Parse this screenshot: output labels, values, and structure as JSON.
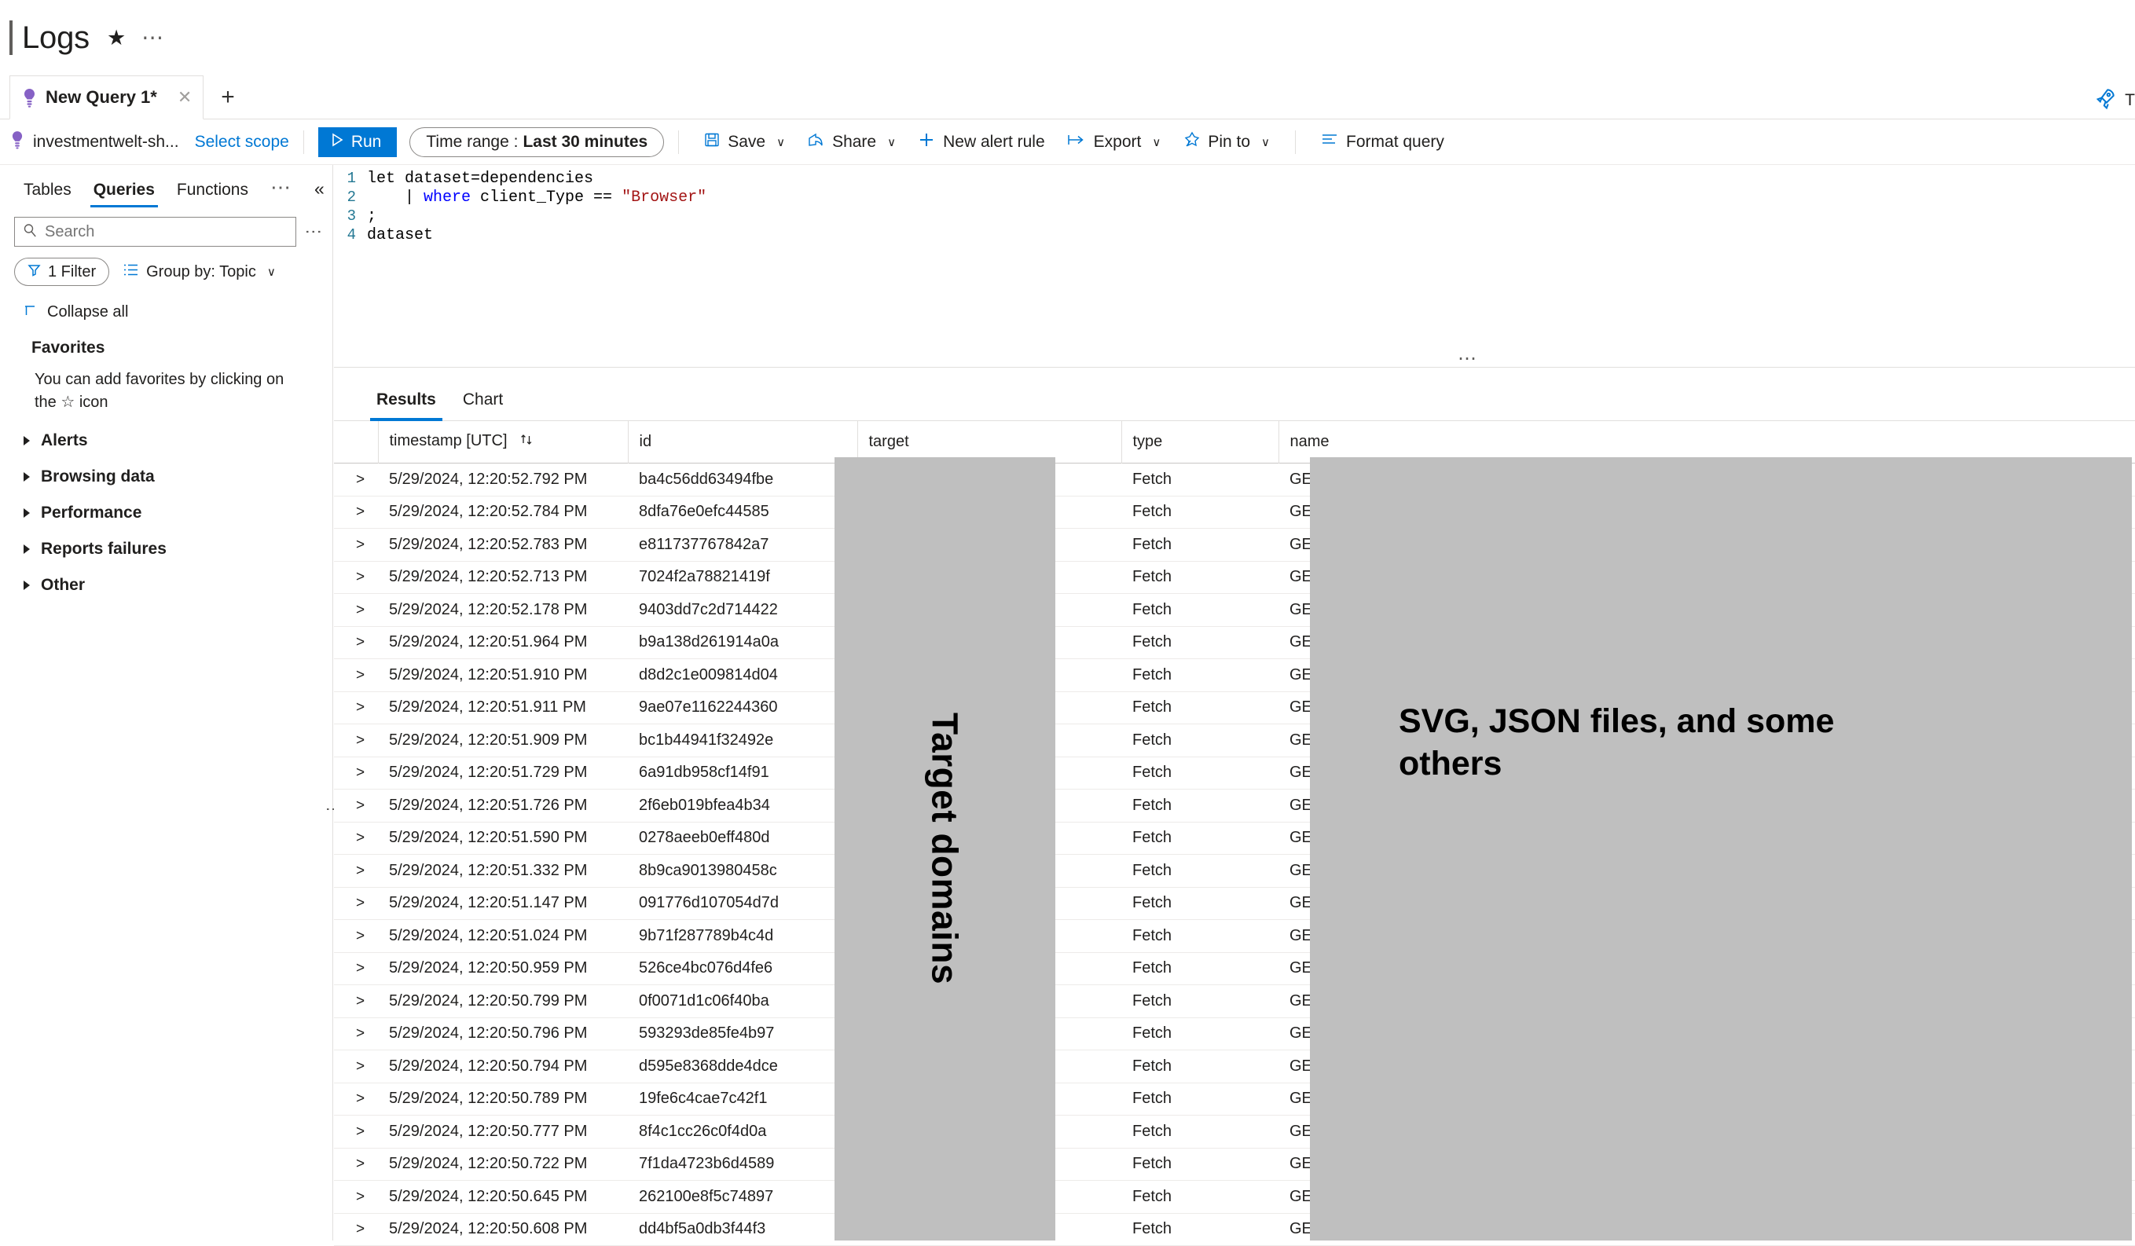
{
  "header": {
    "title": "Logs",
    "favorite_icon": "star-icon",
    "more_icon": "ellipsis-icon"
  },
  "query_tabs": {
    "tabs": [
      {
        "label": "New Query 1*",
        "icon": "lightbulb-icon",
        "close_icon": "close-icon",
        "active": true
      }
    ],
    "add_label": "+",
    "rocket_label": "T",
    "rocket_icon": "rocket-icon"
  },
  "command_bar": {
    "scope_icon": "lightbulb-icon",
    "scope_name": "investmentwelt-sh...",
    "select_scope": "Select scope",
    "run": {
      "label": "Run",
      "icon": "play-icon"
    },
    "time_range": {
      "label": "Time range :",
      "value": "Last 30 minutes"
    },
    "buttons": [
      {
        "label": "Save",
        "icon": "save-icon",
        "chevron": "∨"
      },
      {
        "label": "Share",
        "icon": "share-icon",
        "chevron": "∨"
      },
      {
        "label": "New alert rule",
        "icon": "plus-icon",
        "chevron": ""
      },
      {
        "label": "Export",
        "icon": "export-icon",
        "chevron": "∨"
      },
      {
        "label": "Pin to",
        "icon": "pin-icon",
        "chevron": "∨"
      },
      {
        "label": "Format query",
        "icon": "format-icon",
        "chevron": ""
      }
    ]
  },
  "sidebar": {
    "tabs": [
      {
        "label": "Tables",
        "active": false
      },
      {
        "label": "Queries",
        "active": true
      },
      {
        "label": "Functions",
        "active": false
      }
    ],
    "more_icon": "ellipsis-icon",
    "collapse_icon": "chevron-double-left-icon",
    "search": {
      "placeholder": "Search",
      "value": "",
      "icon": "search-icon"
    },
    "kebab_icon": "kebab-menu-icon",
    "filter_pill": {
      "label": "1 Filter",
      "icon": "filter-icon"
    },
    "group_by": {
      "label": "Group by: Topic",
      "icon": "list-icon",
      "chevron": "∨"
    },
    "collapse_all": {
      "label": "Collapse all",
      "icon": "collapse-all-icon"
    },
    "favorites_title": "Favorites",
    "favorites_hint": "You can add favorites by clicking on the ☆ icon",
    "tree": [
      {
        "label": "Alerts"
      },
      {
        "label": "Browsing data"
      },
      {
        "label": "Performance"
      },
      {
        "label": "Reports failures"
      },
      {
        "label": "Other"
      }
    ]
  },
  "editor": {
    "lines": [
      {
        "num": "1",
        "segments": [
          {
            "text": "let dataset=dependencies",
            "style": "plain"
          }
        ]
      },
      {
        "num": "2",
        "segments": [
          {
            "text": "    | ",
            "style": "plain"
          },
          {
            "text": "where",
            "style": "kw"
          },
          {
            "text": " client_Type == ",
            "style": "plain"
          },
          {
            "text": "\"Browser\"",
            "style": "str"
          }
        ]
      },
      {
        "num": "3",
        "segments": [
          {
            "text": ";",
            "style": "plain"
          }
        ]
      },
      {
        "num": "4",
        "segments": [
          {
            "text": "dataset",
            "style": "plain"
          }
        ]
      }
    ],
    "drag_handle_icon": "drag-dots-icon"
  },
  "results": {
    "tabs": [
      {
        "label": "Results",
        "active": true
      },
      {
        "label": "Chart",
        "active": false
      }
    ],
    "columns": [
      {
        "key": "expand",
        "label": ""
      },
      {
        "key": "timestamp",
        "label": "timestamp [UTC]",
        "sort_icon": "sort-asc-desc-icon"
      },
      {
        "key": "id",
        "label": "id"
      },
      {
        "key": "target",
        "label": "target"
      },
      {
        "key": "type",
        "label": "type"
      },
      {
        "key": "name",
        "label": "name"
      }
    ],
    "rows": [
      {
        "expand": ">",
        "timestamp": "5/29/2024, 12:20:52.792 PM",
        "id": "ba4c56dd63494fbe",
        "target": "",
        "type": "Fetch",
        "name": "GET http"
      },
      {
        "expand": ">",
        "timestamp": "5/29/2024, 12:20:52.784 PM",
        "id": "8dfa76e0efc44585",
        "target": "",
        "type": "Fetch",
        "name": "GET http"
      },
      {
        "expand": ">",
        "timestamp": "5/29/2024, 12:20:52.783 PM",
        "id": "e811737767842a7",
        "target": "",
        "type": "Fetch",
        "name": "GET http"
      },
      {
        "expand": ">",
        "timestamp": "5/29/2024, 12:20:52.713 PM",
        "id": "7024f2a78821419f",
        "target": "",
        "type": "Fetch",
        "name": "GET http"
      },
      {
        "expand": ">",
        "timestamp": "5/29/2024, 12:20:52.178 PM",
        "id": "9403dd7c2d714422",
        "target": "",
        "type": "Fetch",
        "name": "GET http"
      },
      {
        "expand": ">",
        "timestamp": "5/29/2024, 12:20:51.964 PM",
        "id": "b9a138d261914a0a",
        "target": "",
        "type": "Fetch",
        "name": "GET http"
      },
      {
        "expand": ">",
        "timestamp": "5/29/2024, 12:20:51.910 PM",
        "id": "d8d2c1e009814d04",
        "target": "",
        "type": "Fetch",
        "name": "GET http"
      },
      {
        "expand": ">",
        "timestamp": "5/29/2024, 12:20:51.911 PM",
        "id": "9ae07e1162244360",
        "target": "",
        "type": "Fetch",
        "name": "GET http"
      },
      {
        "expand": ">",
        "timestamp": "5/29/2024, 12:20:51.909 PM",
        "id": "bc1b44941f32492e",
        "target": "",
        "type": "Fetch",
        "name": "GET http"
      },
      {
        "expand": ">",
        "timestamp": "5/29/2024, 12:20:51.729 PM",
        "id": "6a91db958cf14f91",
        "target": "",
        "type": "Fetch",
        "name": "GET http"
      },
      {
        "expand": ">",
        "timestamp": "5/29/2024, 12:20:51.726 PM",
        "id": "2f6eb019bfea4b34",
        "target": "",
        "type": "Fetch",
        "name": "GET http"
      },
      {
        "expand": ">",
        "timestamp": "5/29/2024, 12:20:51.590 PM",
        "id": "0278aeeb0eff480d",
        "target": "",
        "type": "Fetch",
        "name": "GET /o/u"
      },
      {
        "expand": ">",
        "timestamp": "5/29/2024, 12:20:51.332 PM",
        "id": "8b9ca9013980458c",
        "target": "",
        "type": "Fetch",
        "name": "GET /o/u"
      },
      {
        "expand": ">",
        "timestamp": "5/29/2024, 12:20:51.147 PM",
        "id": "091776d107054d7d",
        "target": "",
        "type": "Fetch",
        "name": "GET /o/u"
      },
      {
        "expand": ">",
        "timestamp": "5/29/2024, 12:20:51.024 PM",
        "id": "9b71f287789b4c4d",
        "target": "",
        "type": "Fetch",
        "name": "GET data"
      },
      {
        "expand": ">",
        "timestamp": "5/29/2024, 12:20:50.959 PM",
        "id": "526ce4bc076d4fe6",
        "target": "",
        "type": "Fetch",
        "name": "GET http"
      },
      {
        "expand": ">",
        "timestamp": "5/29/2024, 12:20:50.799 PM",
        "id": "0f0071d1c06f40ba",
        "target": "",
        "type": "Fetch",
        "name": "GET http"
      },
      {
        "expand": ">",
        "timestamp": "5/29/2024, 12:20:50.796 PM",
        "id": "593293de85fe4b97",
        "target": "",
        "type": "Fetch",
        "name": "GET http"
      },
      {
        "expand": ">",
        "timestamp": "5/29/2024, 12:20:50.794 PM",
        "id": "d595e8368dde4dce",
        "target": "",
        "type": "Fetch",
        "name": "GET http"
      },
      {
        "expand": ">",
        "timestamp": "5/29/2024, 12:20:50.789 PM",
        "id": "19fe6c4cae7c42f1",
        "target": "",
        "type": "Fetch",
        "name": "GET http"
      },
      {
        "expand": ">",
        "timestamp": "5/29/2024, 12:20:50.777 PM",
        "id": "8f4c1cc26c0f4d0a",
        "target": "",
        "type": "Fetch",
        "name": "GET /o/g"
      },
      {
        "expand": ">",
        "timestamp": "5/29/2024, 12:20:50.722 PM",
        "id": "7f1da4723b6d4589",
        "target": "",
        "type": "Fetch",
        "name": "GET http"
      },
      {
        "expand": ">",
        "timestamp": "5/29/2024, 12:20:50.645 PM",
        "id": "262100e8f5c74897",
        "target": "",
        "type": "Fetch",
        "name": "GET http"
      },
      {
        "expand": ">",
        "timestamp": "5/29/2024, 12:20:50.608 PM",
        "id": "dd4bf5a0db3f44f3",
        "target": "",
        "type": "Fetch",
        "name": "GET http"
      }
    ]
  },
  "annotations": {
    "target_column_label": "Target domains",
    "name_column_note": "SVG, JSON files, and some others"
  },
  "colors": {
    "accent": "#0078d4",
    "text": "#201f1e",
    "border": "#e1dfdd",
    "redaction": "#bfbfbf",
    "keyword": "#0000ff",
    "string": "#a31515",
    "line_number": "#237893"
  }
}
